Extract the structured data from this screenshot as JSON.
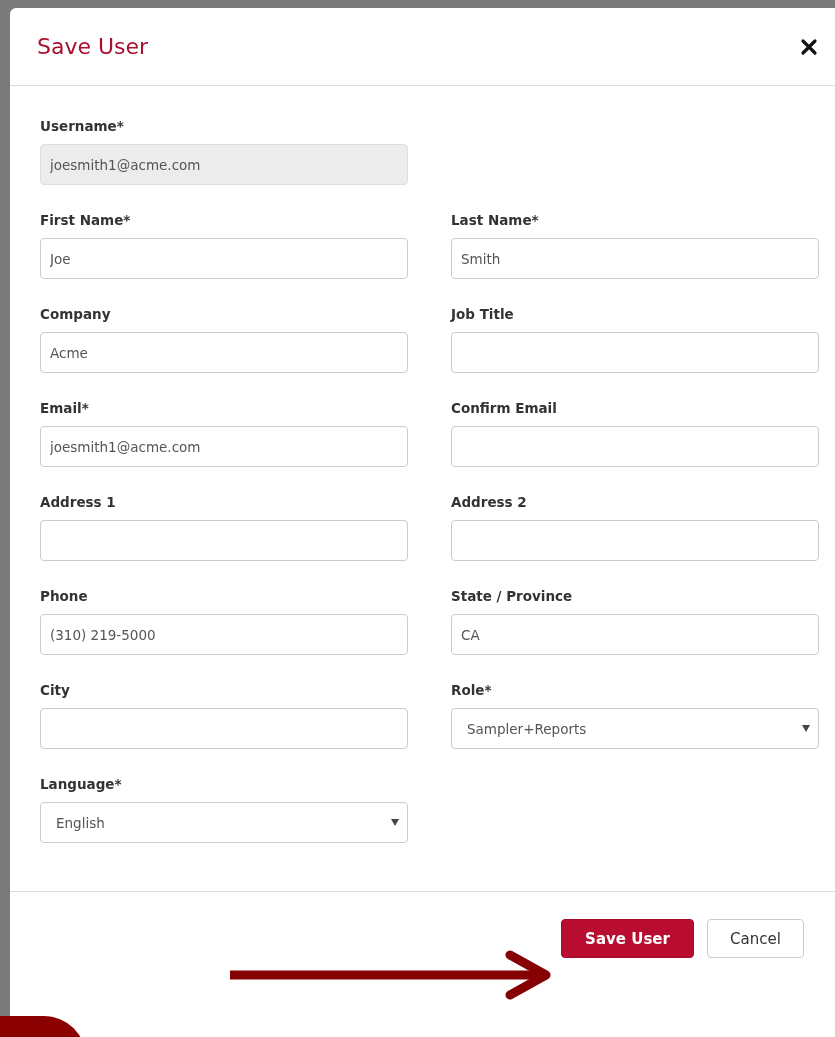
{
  "dialog": {
    "title": "Save User"
  },
  "rows": [
    {
      "fields": [
        {
          "label": "Username*",
          "kind": "text",
          "value": "joesmith1@acme.com",
          "disabled": true
        }
      ]
    },
    {
      "fields": [
        {
          "label": "First Name*",
          "kind": "text",
          "value": "Joe",
          "disabled": false
        },
        {
          "label": "Last Name*",
          "kind": "text",
          "value": "Smith",
          "disabled": false
        }
      ]
    },
    {
      "fields": [
        {
          "label": "Company",
          "kind": "text",
          "value": "Acme",
          "disabled": false
        },
        {
          "label": "Job Title",
          "kind": "text",
          "disabled": false
        }
      ]
    },
    {
      "fields": [
        {
          "label": "Email*",
          "kind": "text",
          "value": "joesmith1@acme.com",
          "disabled": false
        },
        {
          "label": "Confirm Email",
          "kind": "text",
          "disabled": false
        }
      ]
    },
    {
      "fields": [
        {
          "label": "Address 1",
          "kind": "text",
          "disabled": false
        },
        {
          "label": "Address 2",
          "kind": "text",
          "disabled": false
        }
      ]
    },
    {
      "fields": [
        {
          "label": "Phone",
          "kind": "text",
          "value": "(310) 219-5000",
          "disabled": false
        },
        {
          "label": "State / Province",
          "kind": "text",
          "value": "CA",
          "disabled": false
        }
      ]
    },
    {
      "fields": [
        {
          "label": "City",
          "kind": "text",
          "disabled": false
        },
        {
          "label": "Role*",
          "kind": "select",
          "value": "Sampler+Reports",
          "disabled": false
        }
      ]
    },
    {
      "fields": [
        {
          "label": "Language*",
          "kind": "select",
          "value": "English",
          "disabled": false
        }
      ]
    }
  ],
  "buttons": [
    {
      "label": "Save User",
      "kind": "primary"
    },
    {
      "label": "Cancel",
      "kind": "default"
    }
  ]
}
